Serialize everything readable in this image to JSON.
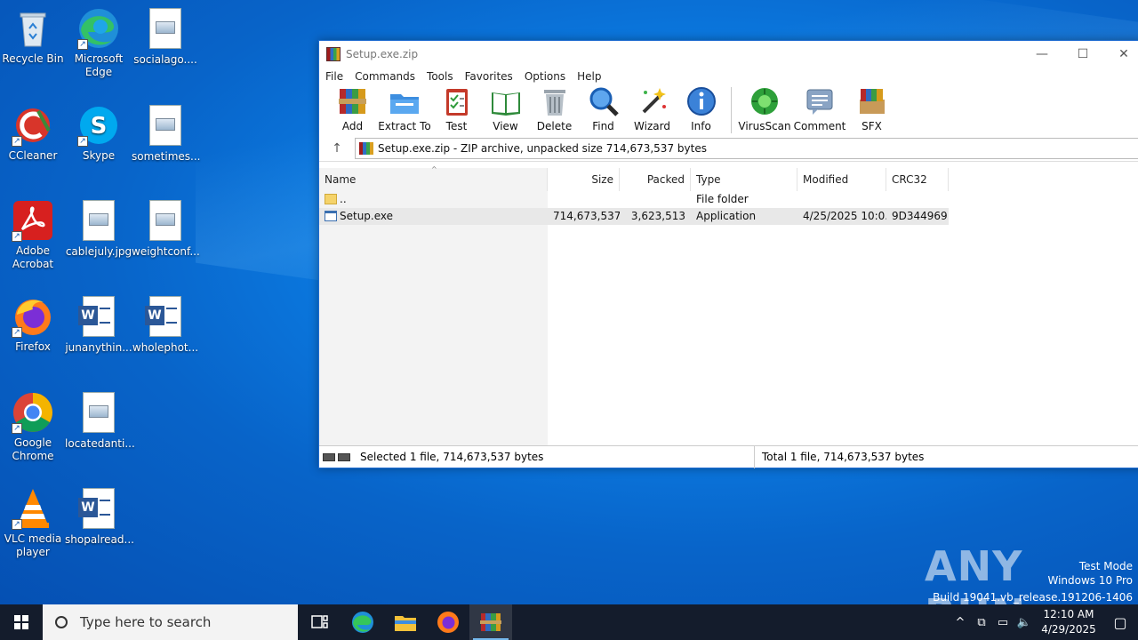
{
  "desktop": {
    "icons": [
      {
        "label": "Recycle Bin"
      },
      {
        "label": "Microsoft Edge"
      },
      {
        "label": "socialago...."
      },
      {
        "label": "CCleaner"
      },
      {
        "label": "Skype"
      },
      {
        "label": "sometimes..."
      },
      {
        "label": "Adobe Acrobat"
      },
      {
        "label": "cablejuly.jpg"
      },
      {
        "label": "weightconf..."
      },
      {
        "label": "Firefox"
      },
      {
        "label": "junanythin..."
      },
      {
        "label": "wholephot..."
      },
      {
        "label": "Google Chrome"
      },
      {
        "label": "locatedanti..."
      },
      {
        "label": "VLC media player"
      },
      {
        "label": "shopalread..."
      }
    ]
  },
  "window": {
    "title": "Setup.exe.zip",
    "controls": {
      "minimize": "—",
      "maximize": "☐",
      "close": "✕"
    },
    "menu": [
      "File",
      "Commands",
      "Tools",
      "Favorites",
      "Options",
      "Help"
    ],
    "toolbar": [
      "Add",
      "Extract To",
      "Test",
      "View",
      "Delete",
      "Find",
      "Wizard",
      "Info",
      "VirusScan",
      "Comment",
      "SFX"
    ],
    "address": "Setup.exe.zip - ZIP archive, unpacked size 714,673,537 bytes",
    "columns": [
      "Name",
      "Size",
      "Packed",
      "Type",
      "Modified",
      "CRC32"
    ],
    "rows": [
      {
        "name": "..",
        "size": "",
        "packed": "",
        "type": "File folder",
        "modified": "",
        "crc": ""
      },
      {
        "name": "Setup.exe",
        "size": "714,673,537",
        "packed": "3,623,513",
        "type": "Application",
        "modified": "4/25/2025 10:0...",
        "crc": "9D344969"
      }
    ],
    "status_left": "Selected 1 file, 714,673,537 bytes",
    "status_right": "Total 1 file, 714,673,537 bytes"
  },
  "watermark": {
    "logo": "ANY RUN",
    "line1": "Test Mode",
    "line2": "Windows 10 Pro",
    "line3": "Build 19041.vb_release.191206-1406"
  },
  "taskbar": {
    "search_placeholder": "Type here to search",
    "time": "12:10 AM",
    "date": "4/29/2025"
  },
  "colors": {
    "desktop": "#0c7fe6",
    "taskbar": "#141c2c",
    "window_border": "#1e6bd0"
  }
}
